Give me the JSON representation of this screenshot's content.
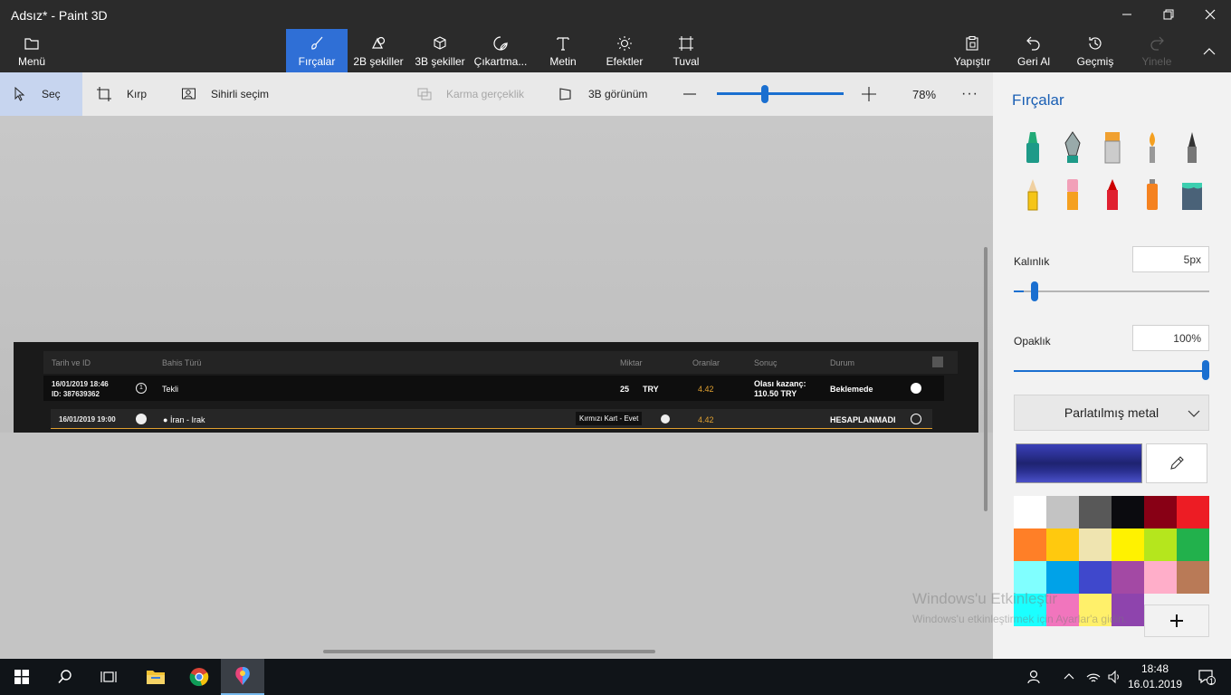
{
  "window": {
    "title": "Adsız* - Paint 3D"
  },
  "ribbon": {
    "menu": "Menü",
    "tools": [
      {
        "label": "Fırçalar",
        "icon": "brush-icon",
        "active": true
      },
      {
        "label": "2B şekiller",
        "icon": "2d-shapes-icon"
      },
      {
        "label": "3B şekiller",
        "icon": "3d-shapes-icon"
      },
      {
        "label": "Çıkartma...",
        "icon": "sticker-icon"
      },
      {
        "label": "Metin",
        "icon": "text-icon"
      },
      {
        "label": "Efektler",
        "icon": "effects-icon"
      },
      {
        "label": "Tuval",
        "icon": "canvas-icon"
      }
    ],
    "right": [
      {
        "label": "Yapıştır",
        "icon": "paste-icon"
      },
      {
        "label": "Geri Al",
        "icon": "undo-icon"
      },
      {
        "label": "Geçmiş",
        "icon": "history-icon"
      },
      {
        "label": "Yinele",
        "icon": "redo-icon",
        "disabled": true
      }
    ]
  },
  "toolbar": {
    "select": "Seç",
    "crop": "Kırp",
    "magic_select": "Sihirli seçim",
    "mixed_reality": "Karma gerçeklik",
    "view_3d": "3B görünüm",
    "zoom_value": "78%",
    "zoom_fraction": 0.38
  },
  "panel": {
    "title": "Fırçalar",
    "thickness_label": "Kalınlık",
    "thickness_value": "5px",
    "thickness_fraction": 0.05,
    "opacity_label": "Opaklık",
    "opacity_value": "100%",
    "opacity_fraction": 1.0,
    "material": "Parlatılmış metal",
    "current_color": "#2a2f8f",
    "palette": [
      "#ffffff",
      "#c3c3c3",
      "#585858",
      "#0b0b0f",
      "#880015",
      "#ed1c24",
      "#ff7f27",
      "#ffc90e",
      "#efe4b0",
      "#fff200",
      "#b5e61d",
      "#22b14c",
      "#80ffff",
      "#00a2e8",
      "#3f48cc",
      "#a349a4",
      "#ffaec9",
      "#b97a57",
      "#1bffff",
      "#f175bd",
      "#fff06a",
      "#8e44ad"
    ]
  },
  "watermark": {
    "title": "Windows'u Etkinleştir",
    "subtitle": "Windows'u etkinleştirmek için Ayarlar'a gidin."
  },
  "sheet": {
    "headers": [
      "Tarih ve ID",
      "Bahis Türü",
      "Miktar",
      "Oranlar",
      "Sonuç",
      "Durum"
    ],
    "row1": {
      "date": "16/01/2019 18:46",
      "id": "ID: 387639362",
      "type": "Tekli",
      "amount": "25",
      "currency": "TRY",
      "odds": "4.42",
      "result_line1": "Olası kazanç:",
      "result_line2": "110.50 TRY",
      "status": "Beklemede"
    },
    "row2": {
      "date": "16/01/2019 19:00",
      "match": "İran - Irak",
      "market": "Kırmızı Kart - Evet",
      "odds": "4.42",
      "status": "HESAPLANMADI"
    }
  },
  "taskbar": {
    "time": "18:48",
    "date": "16.01.2019",
    "notifications": "1"
  }
}
